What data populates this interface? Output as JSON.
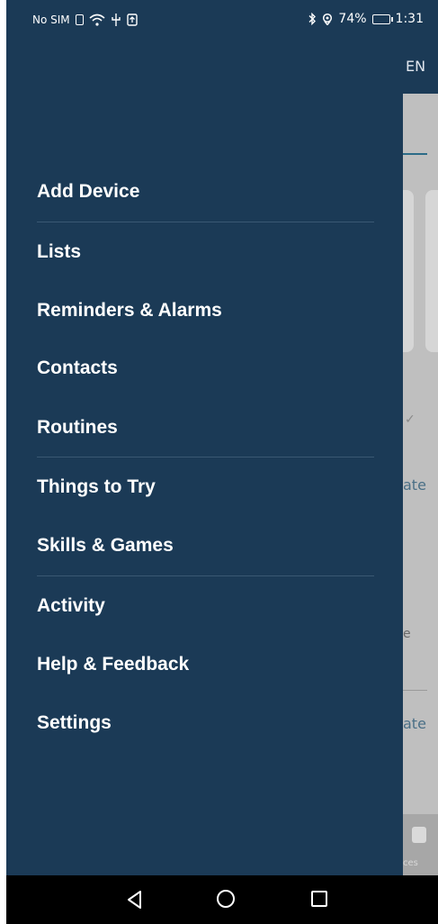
{
  "status_bar": {
    "carrier": "No SIM",
    "battery": "74%",
    "time": "1:31",
    "icons": [
      "sim-icon",
      "wifi-icon",
      "usb-icon",
      "upload-icon",
      "bluetooth-icon",
      "location-icon",
      "battery-icon"
    ]
  },
  "background_app": {
    "header_text": "EN",
    "text_a": "ate",
    "text_e": "e",
    "text_b": "ate",
    "tab_label": "ces",
    "check_glyph": "✓"
  },
  "drawer": {
    "background_color": "#1b3a56",
    "items": [
      {
        "label": "Add Device"
      },
      {
        "label": "Lists"
      },
      {
        "label": "Reminders & Alarms"
      },
      {
        "label": "Contacts"
      },
      {
        "label": "Routines"
      },
      {
        "label": "Things to Try"
      },
      {
        "label": "Skills & Games"
      },
      {
        "label": "Activity"
      },
      {
        "label": "Help & Feedback"
      },
      {
        "label": "Settings"
      }
    ]
  },
  "navbar": {
    "buttons": [
      "back-icon",
      "home-icon",
      "recent-apps-icon"
    ]
  }
}
